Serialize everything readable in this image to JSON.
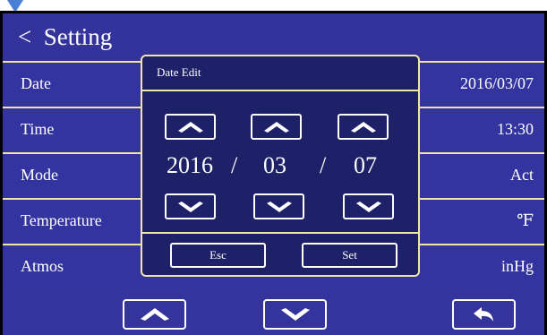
{
  "header": {
    "back_symbol": "<",
    "title": "Setting"
  },
  "rows": [
    {
      "label": "Date",
      "value": "2016/03/07"
    },
    {
      "label": "Time",
      "value": "13:30"
    },
    {
      "label": "Mode",
      "value": "Act"
    },
    {
      "label": "Temperature",
      "value": "℉"
    },
    {
      "label": "Atmos",
      "value": "inHg"
    }
  ],
  "dialog": {
    "title": "Date Edit",
    "year": "2016",
    "month": "03",
    "day": "07",
    "separator": "/",
    "esc_label": "Esc",
    "set_label": "Set"
  },
  "icons": {
    "up": "chevron-up-icon",
    "down": "chevron-down-icon",
    "return": "return-arrow-icon",
    "cursor": "triangle-cursor-icon"
  },
  "colors": {
    "panel": "#34349c",
    "dialog": "#1e2068",
    "divider": "#f0e7a6",
    "cursor": "#4a7fd6"
  }
}
